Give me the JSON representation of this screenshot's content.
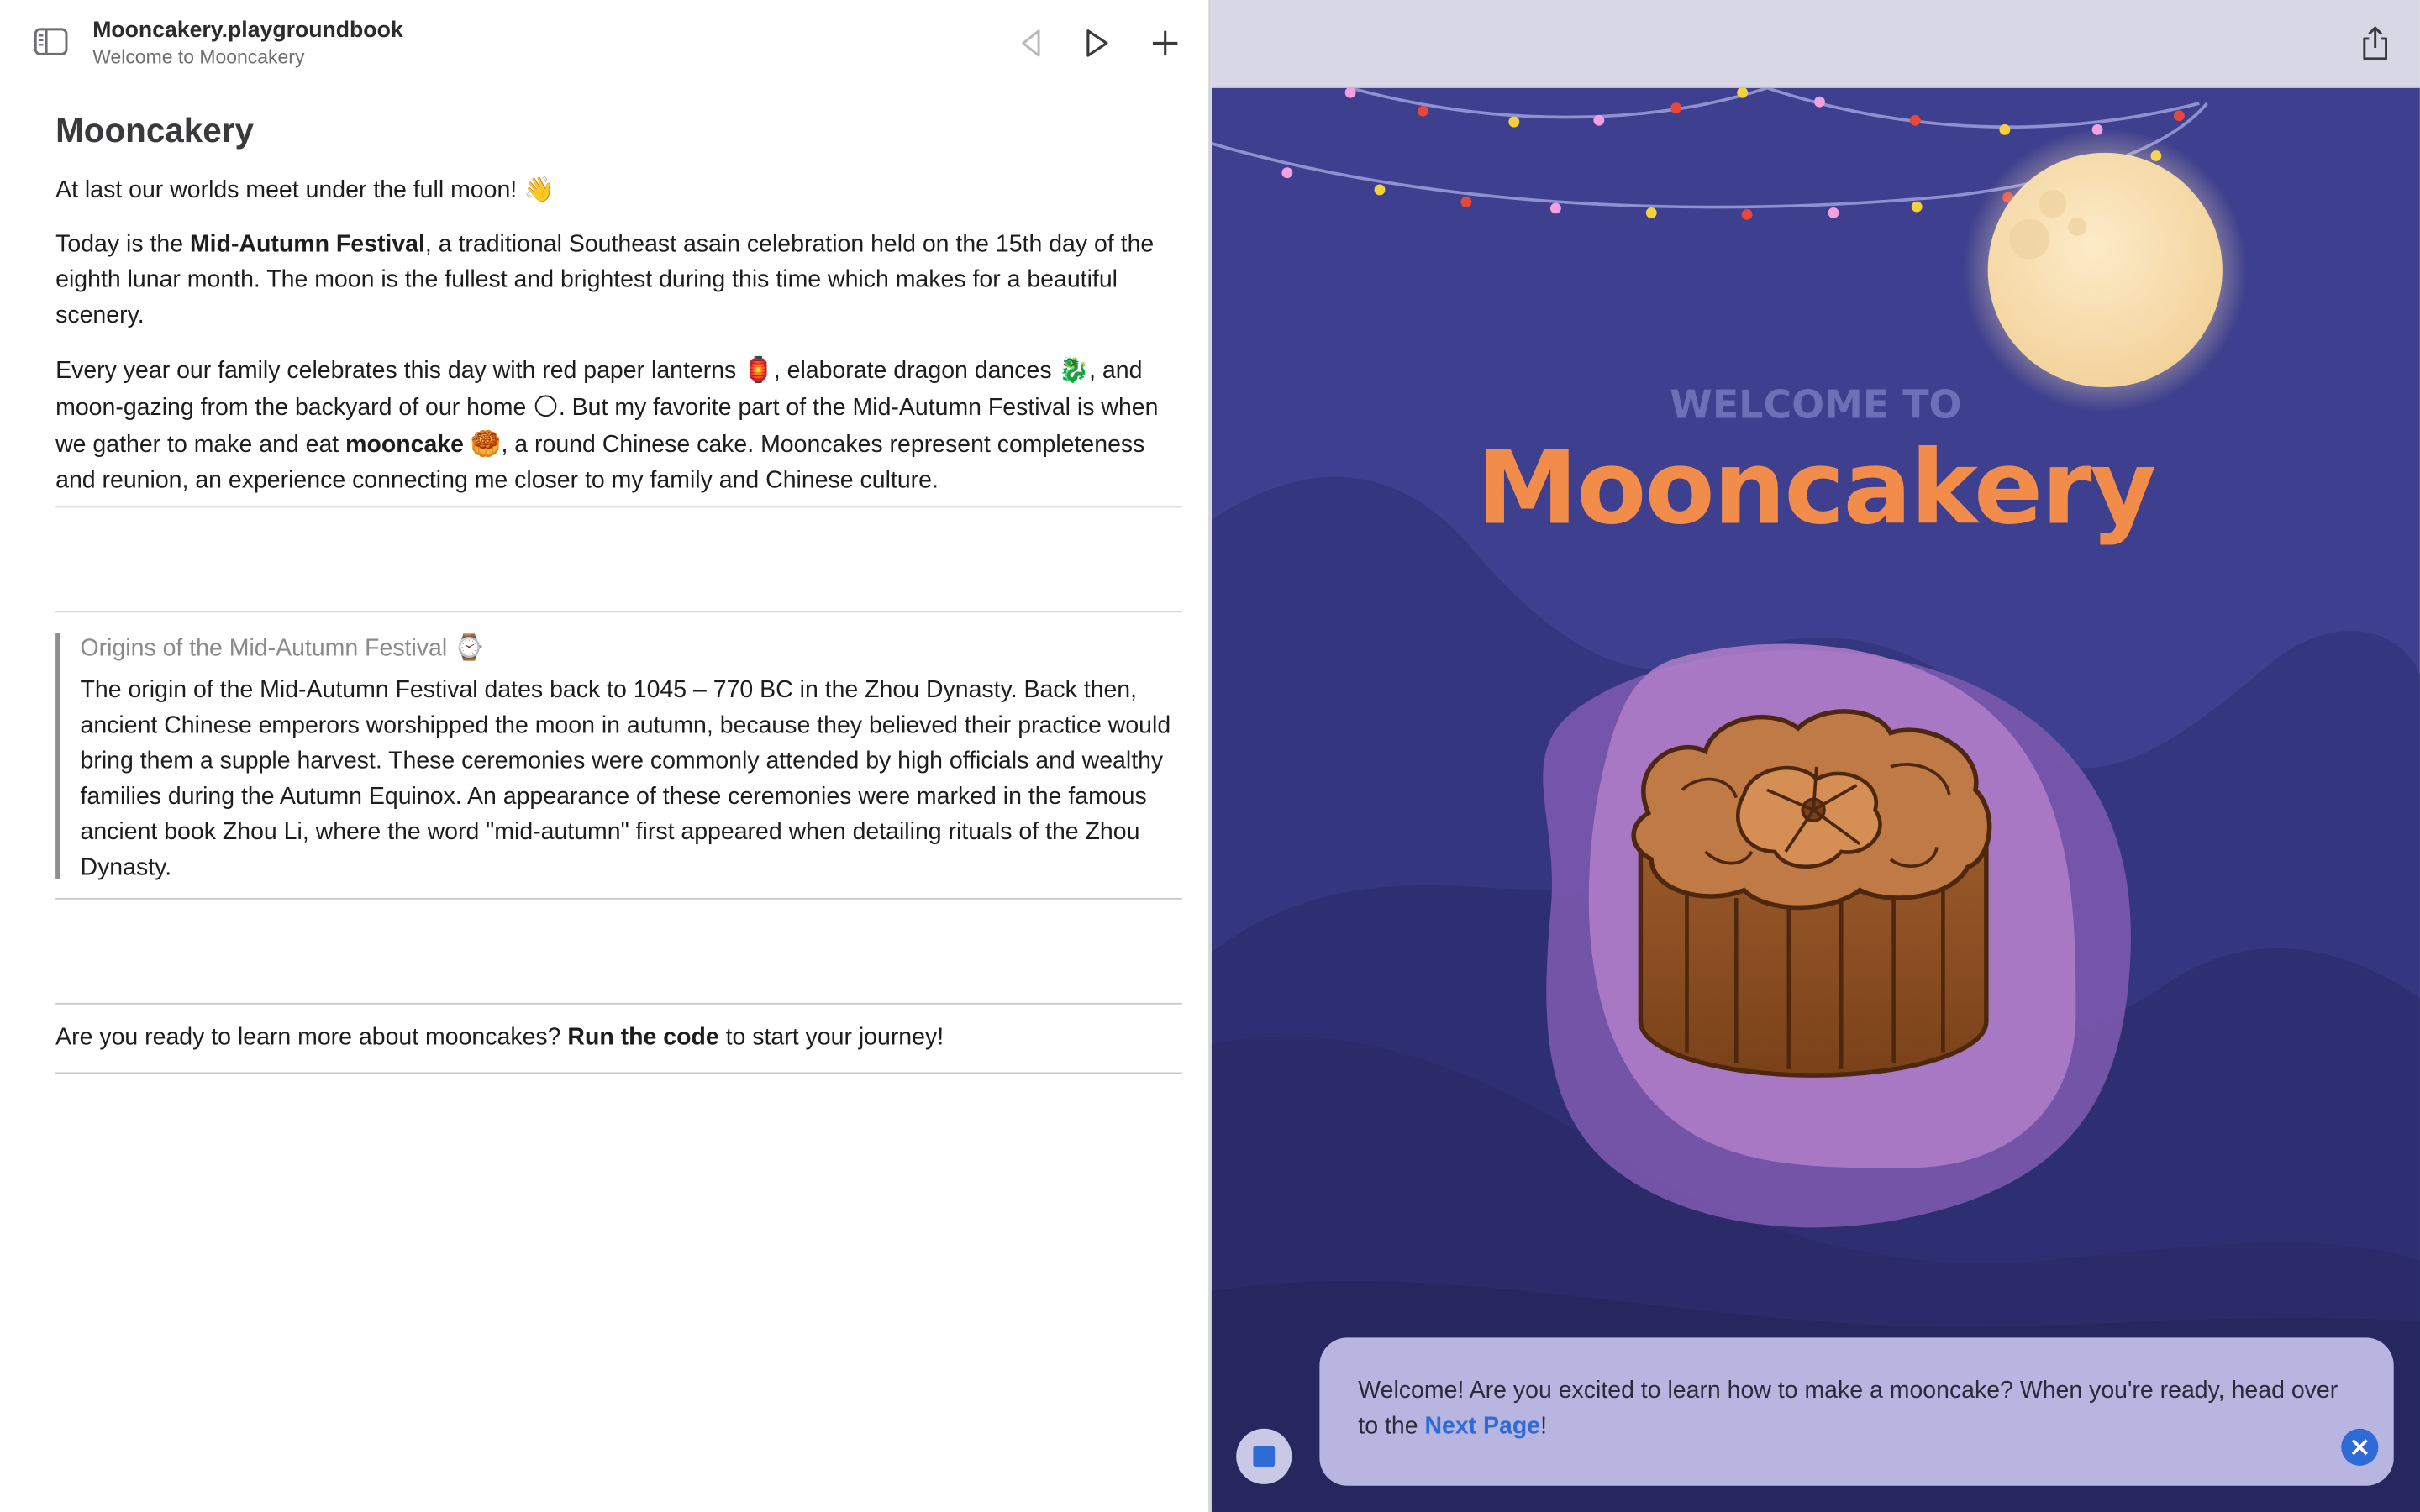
{
  "toolbar": {
    "doc_title": "Mooncakery.playgroundbook",
    "doc_subtitle": "Welcome to Mooncakery"
  },
  "page": {
    "title": "Mooncakery",
    "intro": "At last our worlds meet under the full moon!",
    "intro_emoji": "👋",
    "p1_a": "Today is the ",
    "p1_b": "Mid-Autumn Festival",
    "p1_c": ", a traditional Southeast asain celebration held on the 15th day of the eighth lunar month. The moon is the fullest and brightest during this time which makes for a beautiful scenery.",
    "p2_a": "Every year our family celebrates this day with red paper lanterns ",
    "p2_emoji1": "🏮",
    "p2_b": ", elaborate dragon dances ",
    "p2_emoji2": "🐉",
    "p2_c": ", and moon-gazing from the backyard of our home ",
    "p2_emoji3": "🌕",
    "p2_d": ". But my favorite  part of the Mid-Autumn Festival is when we gather to make and eat ",
    "p2_e": "mooncake",
    "p2_emoji4": "🥮",
    "p2_f": ", a round Chinese cake. Mooncakes represent completeness and reunion, an experience connecting me closer to my family and Chinese culture.",
    "aside_title": "Origins of the Mid-Autumn Festival",
    "aside_emoji": "⌚",
    "aside_text": "The origin of the Mid-Autumn Festival dates back to 1045 – 770 BC in the Zhou Dynasty. Back then, ancient Chinese emperors worshipped the moon in autumn, because they believed their practice would bring them a supple harvest. These ceremonies were commonly attended by high officials and wealthy families during the Autumn Equinox. An appearance of these ceremonies were marked in the famous ancient book Zhou Li, where the word \"mid-autumn\" first appeared when detailing rituals of the Zhou Dynasty.",
    "cta_a": "Are you ready to learn more about mooncakes? ",
    "cta_b": "Run the code",
    "cta_c": " to start your journey!"
  },
  "live_view": {
    "welcome_to": "WELCOME TO",
    "brand": "Mooncakery",
    "bubble_a": "Welcome! Are you excited to learn how to make a mooncake? When you're ready, head over to the ",
    "bubble_link": "Next Page",
    "bubble_c": "!"
  },
  "colors": {
    "sky": "#3e3f8e",
    "moon": "#f8e2b8",
    "brand": "#f28c4a",
    "accent": "#2f6bd6"
  }
}
